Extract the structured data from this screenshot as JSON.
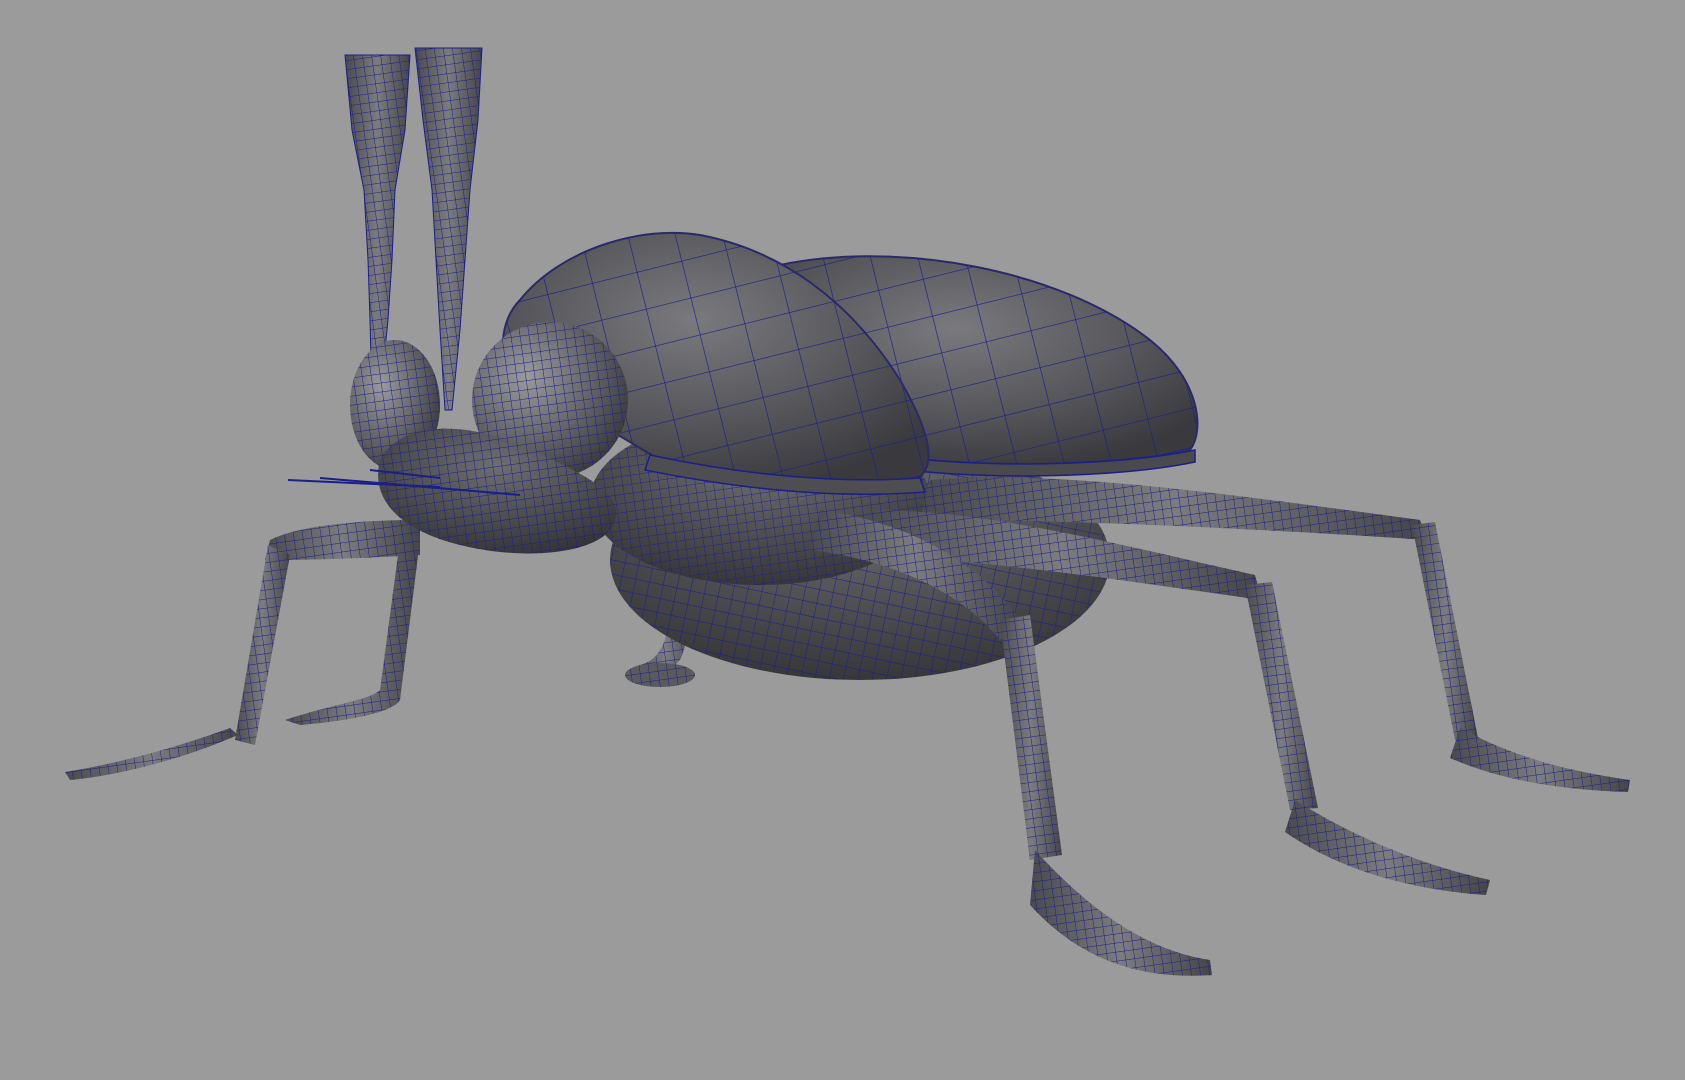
{
  "viewport": {
    "background": "#9b9b9b",
    "model_shade_dark": "#3b3b3d",
    "model_shade_mid": "#5e5e62",
    "model_shade_light": "#8a8a8e",
    "wireframe_color": "#1b1f8a",
    "display_mode": "smooth-shaded-with-wireframe"
  },
  "model": {
    "subject": "beetle-icon",
    "parts": [
      "shell-left-icon",
      "shell-right-icon",
      "eye-left-icon",
      "eye-right-icon",
      "antenna-left-icon",
      "antenna-right-icon",
      "head-icon",
      "whiskers-icon",
      "thorax-icon",
      "abdomen-icon",
      "front-left-leg-icon",
      "front-right-leg-icon",
      "middle-left-leg-icon",
      "middle-right-leg-icon",
      "back-left-leg-icon",
      "back-right-leg-icon"
    ]
  }
}
